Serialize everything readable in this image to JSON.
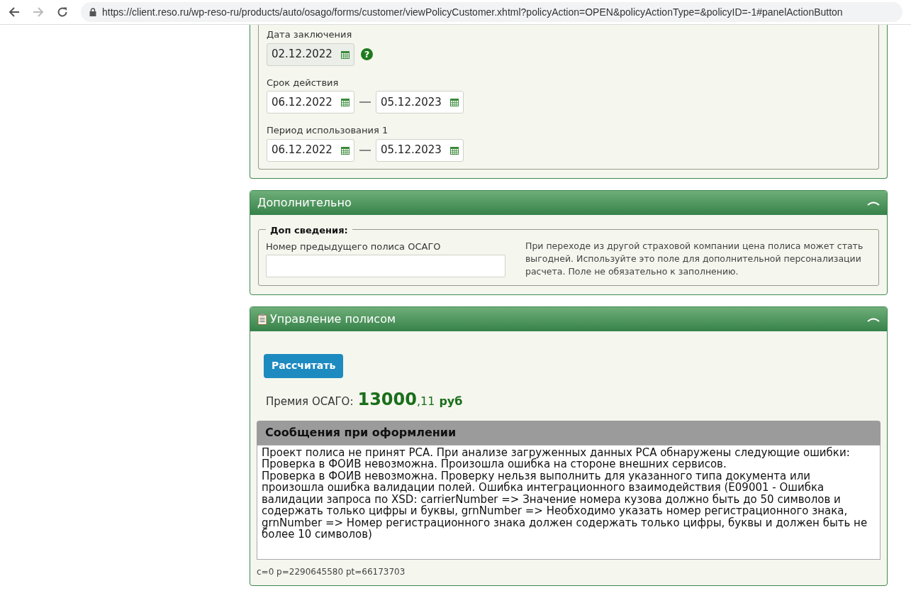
{
  "browser": {
    "url": "https://client.reso.ru/wp-reso-ru/products/auto/osago/forms/customer/viewPolicyCustomer.xhtml?policyAction=OPEN&policyActionType=&policyID=-1#panelActionButton"
  },
  "dates_panel": {
    "fields": [
      {
        "label": "Дата заключения",
        "kind": "single",
        "inputs": [
          {
            "value": "02.12.2022",
            "disabled": true
          }
        ],
        "help": "?"
      },
      {
        "label": "Срок действия",
        "kind": "range",
        "inputs": [
          {
            "value": "06.12.2022",
            "disabled": false
          },
          {
            "value": "05.12.2023",
            "disabled": false
          }
        ]
      },
      {
        "label": "Период использования 1",
        "kind": "range",
        "inputs": [
          {
            "value": "06.12.2022",
            "disabled": false
          },
          {
            "value": "05.12.2023",
            "disabled": false
          }
        ]
      }
    ]
  },
  "extra_panel": {
    "title": "Дополнительно",
    "expanded": true,
    "fieldset": {
      "legend": "Доп сведения:",
      "field_label": "Номер предыдущего полиса ОСАГО",
      "hint": "При переходе из другой страховой компании цена полиса может стать выгодней. Используйте это поле для дополнительной персонализации расчета. Поле не обязательно к заполнению."
    }
  },
  "policy_panel": {
    "title": "Управление полисом",
    "expanded": true,
    "button": "Рассчитать",
    "premium": {
      "label": "Премия ОСАГО:",
      "integer": "13000",
      "fraction": ",11",
      "currency": "руб"
    },
    "messages": {
      "title": "Сообщения при оформлении",
      "lines": [
        "Проект полиса не принят РСА. При анализе загруженных данных РСА обнаружены следующие ошибки:",
        "Проверка в ФОИВ невозможна. Произошла ошибка на стороне внешних сервисов.",
        "Проверка в ФОИВ невозможна. Проверку нельзя выполнить для указанного типа документа или произошла ошибка валидации полей. Ошибка интеграционного взаимодействия (E09001 - Ошибка валидации запроса по XSD: carrierNumber => Значение номера кузова должно быть до 50 символов и содержать только цифры и буквы, grnNumber => Необходимо указать номер регистрационного знака, grnNumber => Номер регистрационного знака должен содержать только цифры, буквы и должен быть не более 10 символов)"
      ]
    },
    "footer": "c=0 p=2290645580 pt=66173703"
  }
}
